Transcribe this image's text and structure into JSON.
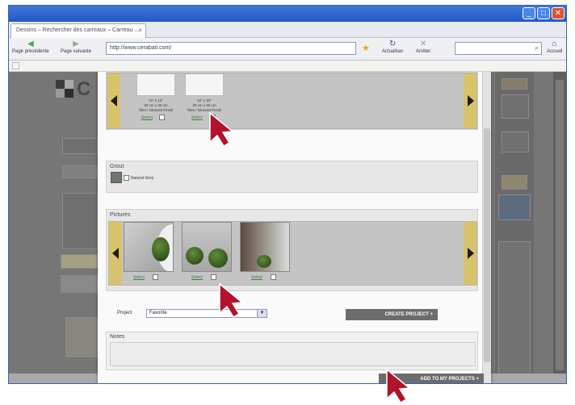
{
  "browser": {
    "tab_title": "Dessins – Rechercher des carreaux – Carreau ...",
    "tab_close": "×",
    "url": "http://www.cerabati.com/",
    "nav_back": "Page précédente",
    "nav_forward": "Page suivante",
    "reload": "Actualiser",
    "stop": "Arrêter",
    "home": "Accueil",
    "window_min": "_",
    "window_max": "□",
    "window_close": "✕"
  },
  "modal": {
    "formats": [
      {
        "size": "12\" x 12\"",
        "detail_1": "30 cm x 30 cm",
        "detail_2": "Tiles / Glossed Finish",
        "select_label": "Select"
      },
      {
        "size": "12\" x 24\"",
        "detail_1": "30 cm x 60 cm",
        "detail_2": "Tiles / Glossed Finish",
        "select_label": "Select"
      }
    ],
    "grout": {
      "title": "Grout",
      "option_label": "Natural Grey",
      "color": "#6f786c"
    },
    "pictures": {
      "title": "Pictures",
      "items": [
        {
          "select_label": "Select"
        },
        {
          "select_label": "Select"
        },
        {
          "select_label": "Select"
        }
      ]
    },
    "project": {
      "label": "Project",
      "selected": "Favorite",
      "create_button": "CREATE PROJECT +"
    },
    "notes": {
      "title": "Notes"
    },
    "add_button": "ADD TO MY PROJECTS +"
  },
  "colors": {
    "carousel_arrow_bg": "#d8c36d",
    "pointer_arrow": "#b3122a",
    "dark_button": "#6c6c6c"
  }
}
